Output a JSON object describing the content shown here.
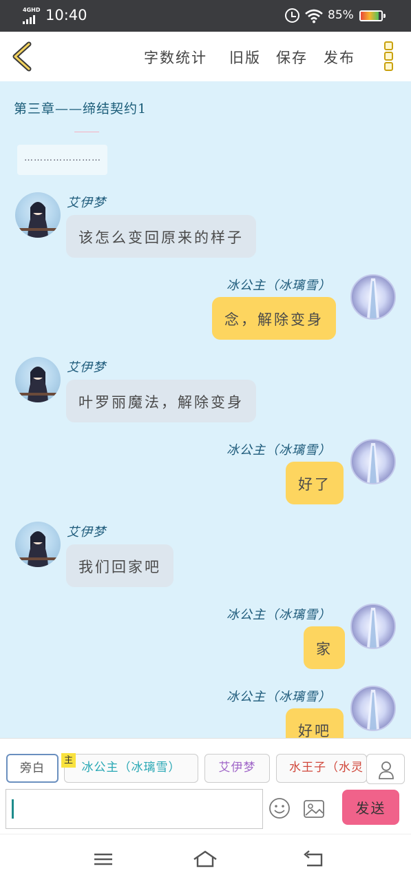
{
  "status_bar": {
    "network": "4GHD",
    "time": "10:40",
    "battery": "85%"
  },
  "top_bar": {
    "menu": [
      "字数统计",
      "旧版",
      "保存",
      "发布"
    ]
  },
  "chat": {
    "chapter_title": "第三章——缔结契约1",
    "narration": "……………………",
    "messages": [
      {
        "side": "left",
        "sender": "艾伊梦",
        "text": "该怎么变回原来的样子"
      },
      {
        "side": "right",
        "sender": "冰公主（冰璃雪）",
        "text": "念，解除变身"
      },
      {
        "side": "left",
        "sender": "艾伊梦",
        "text": "叶罗丽魔法，解除变身"
      },
      {
        "side": "right",
        "sender": "冰公主（冰璃雪）",
        "text": "好了"
      },
      {
        "side": "left",
        "sender": "艾伊梦",
        "text": "我们回家吧"
      },
      {
        "side": "right",
        "sender": "冰公主（冰璃雪）",
        "text": "家"
      },
      {
        "side": "right",
        "sender": "冰公主（冰璃雪）",
        "text": "好吧"
      }
    ]
  },
  "composer": {
    "roles": {
      "narration": "旁白",
      "ice_princess": "冰公主（冰璃雪）",
      "ai_yimeng": "艾伊梦",
      "water_prince": "水王子（水灵"
    },
    "main_badge": "主",
    "input_value": "",
    "send_label": "发送"
  },
  "colors": {
    "chat_background": "#dcf1fb",
    "right_bubble": "#fdd55f",
    "left_bubble": "#dde6ee",
    "send_button": "#f0628a",
    "name_color": "#1d5a7a"
  },
  "icons": [
    "back-chevron-icon",
    "more-icon",
    "emoji-icon",
    "image-icon",
    "person-icon",
    "menu-icon",
    "home-icon",
    "back-icon"
  ]
}
